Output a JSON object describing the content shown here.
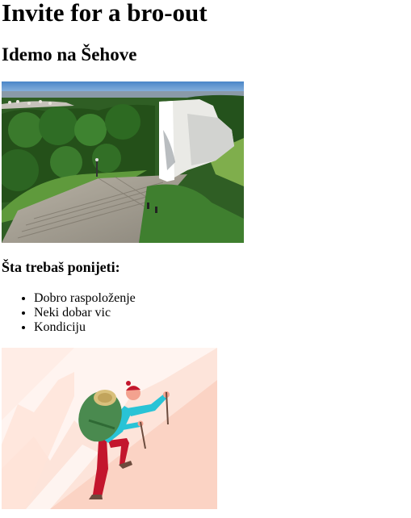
{
  "page": {
    "title": "Invite for a bro-out",
    "subtitle": "Idemo na Šehove",
    "bring_heading": "Šta trebaš ponijeti:",
    "bring_items": [
      "Dobro raspoloženje",
      "Neki dobar vic",
      "Kondiciju"
    ]
  },
  "images": {
    "hero": "photo of a white stone monument on a grassy hill above a city",
    "illustration": "illustration of a hiker with a green backpack climbing a slope"
  },
  "colors": {
    "text": "#000000",
    "background": "#ffffff",
    "illustration_bg": "#fde4da",
    "hiker_backpack": "#4a8a4f",
    "hiker_shirt": "#29c3d6",
    "hiker_pants": "#c3162d"
  }
}
